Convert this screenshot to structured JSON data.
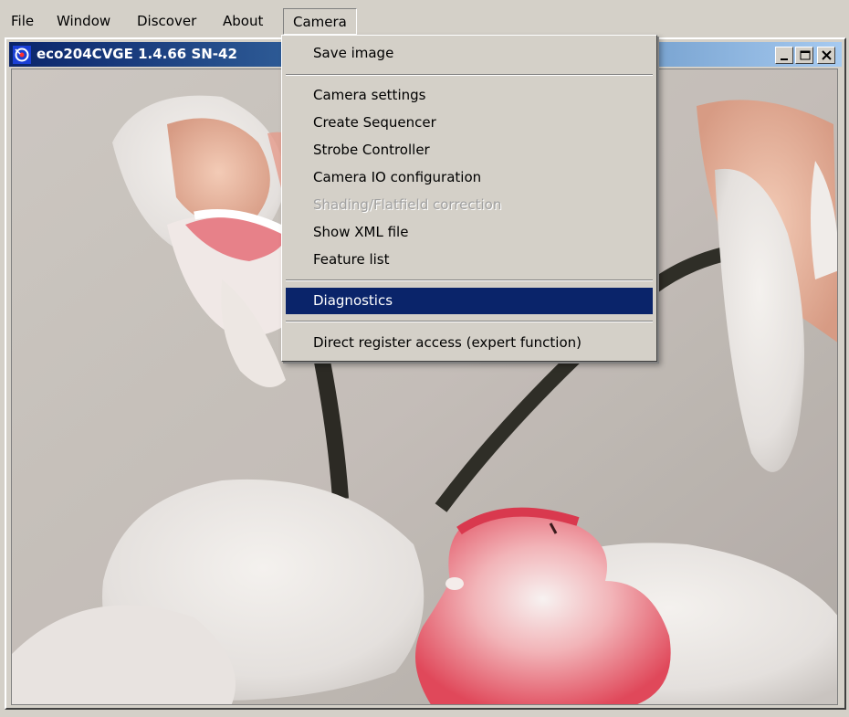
{
  "menubar": {
    "items": [
      {
        "label": "File"
      },
      {
        "label": "Window"
      },
      {
        "label": "Discover"
      },
      {
        "label": "About"
      },
      {
        "label": "Camera"
      }
    ]
  },
  "window": {
    "title": "eco204CVGE 1.4.66  SN-42",
    "buttons": [
      "minimize-icon",
      "maximize-icon",
      "close-icon"
    ]
  },
  "camera_menu": {
    "save_image": "Save image",
    "camera_settings": "Camera settings",
    "create_sequencer": "Create Sequencer",
    "strobe_controller": "Strobe Controller",
    "camera_io": "Camera IO configuration",
    "shading": "Shading/Flatfield correction",
    "show_xml": "Show XML file",
    "feature_list": "Feature list",
    "diagnostics": "Diagnostics",
    "direct_register": "Direct register access (expert function)",
    "disabled_items": [
      "Shading/Flatfield correction"
    ],
    "highlighted_item": "Diagnostics"
  },
  "colors": {
    "menu_bg": "#d4d0c8",
    "highlight": "#0a246a",
    "title_gradient_start": "#0a246a",
    "title_gradient_end": "#a6caf0"
  }
}
